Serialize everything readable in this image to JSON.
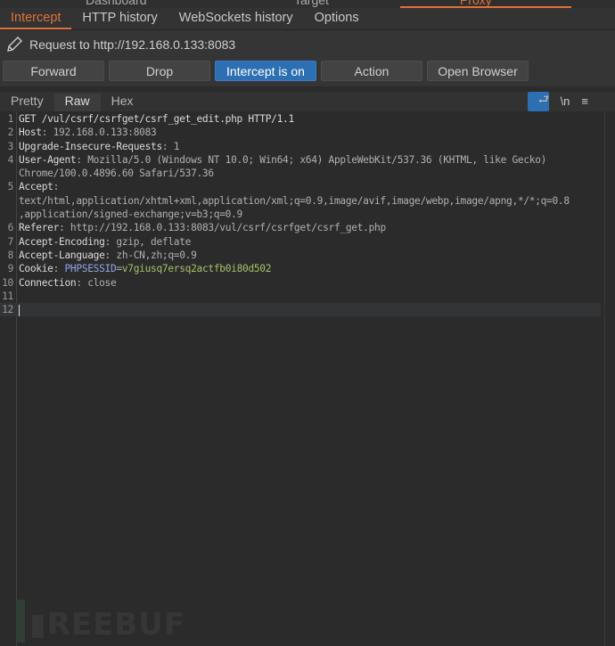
{
  "top_tabs": [
    "Dashboard",
    "Target",
    "Proxy"
  ],
  "sub_tabs": [
    "Intercept",
    "HTTP history",
    "WebSockets history",
    "Options"
  ],
  "request_to": "Request to http://192.168.0.133:8083",
  "buttons": {
    "forward": "Forward",
    "drop": "Drop",
    "intercept": "Intercept is on",
    "action": "Action",
    "open_browser": "Open Browser"
  },
  "editor_tabs": [
    "Pretty",
    "Raw",
    "Hex"
  ],
  "editor_icons": {
    "wrap": "wrap-icon",
    "newline": "\\n",
    "menu": "≡"
  },
  "lines": [
    {
      "num": "1",
      "segs": [
        [
          "n",
          "GET /vul/csrf/csrfget/csrf_get_edit.php HTTP/1.1"
        ]
      ]
    },
    {
      "num": "2",
      "segs": [
        [
          "n",
          "Host"
        ],
        [
          "v",
          ": 192.168.0.133:8083"
        ]
      ]
    },
    {
      "num": "3",
      "segs": [
        [
          "n",
          "Upgrade-Insecure-Requests"
        ],
        [
          "v",
          ": 1"
        ]
      ]
    },
    {
      "num": "4",
      "segs": [
        [
          "n",
          "User-Agent"
        ],
        [
          "v",
          ": Mozilla/5.0 (Windows NT 10.0; Win64; x64) AppleWebKit/537.36 (KHTML, like Gecko)"
        ]
      ]
    },
    {
      "num": "",
      "segs": [
        [
          "v",
          "Chrome/100.0.4896.60 Safari/537.36"
        ]
      ]
    },
    {
      "num": "5",
      "segs": [
        [
          "n",
          "Accept"
        ],
        [
          "v",
          ":"
        ]
      ]
    },
    {
      "num": "",
      "segs": [
        [
          "v",
          "text/html,application/xhtml+xml,application/xml;q=0.9,image/avif,image/webp,image/apng,*/*;q=0.8"
        ]
      ]
    },
    {
      "num": "",
      "segs": [
        [
          "v",
          ",application/signed-exchange;v=b3;q=0.9"
        ]
      ]
    },
    {
      "num": "6",
      "segs": [
        [
          "n",
          "Referer"
        ],
        [
          "v",
          ": http://192.168.0.133:8083/vul/csrf/csrfget/csrf_get.php"
        ]
      ]
    },
    {
      "num": "7",
      "segs": [
        [
          "n",
          "Accept-Encoding"
        ],
        [
          "v",
          ": gzip, deflate"
        ]
      ]
    },
    {
      "num": "8",
      "segs": [
        [
          "n",
          "Accept-Language"
        ],
        [
          "v",
          ": zh-CN,zh;q=0.9"
        ]
      ]
    },
    {
      "num": "9",
      "segs": [
        [
          "n",
          "Cookie"
        ],
        [
          "v",
          ": "
        ],
        [
          "k",
          "PHPSESSID"
        ],
        [
          "v",
          "="
        ],
        [
          "g",
          "v7giusq7ersq2actfb0i80d502"
        ]
      ]
    },
    {
      "num": "10",
      "segs": [
        [
          "n",
          "Connection"
        ],
        [
          "v",
          ": close"
        ]
      ]
    },
    {
      "num": "11",
      "segs": []
    },
    {
      "num": "12",
      "segs": [],
      "cursor": true
    }
  ],
  "watermark": "FREEBUF",
  "colors": {
    "accent": "#e0703a",
    "primary_button": "#2d6fb3"
  }
}
